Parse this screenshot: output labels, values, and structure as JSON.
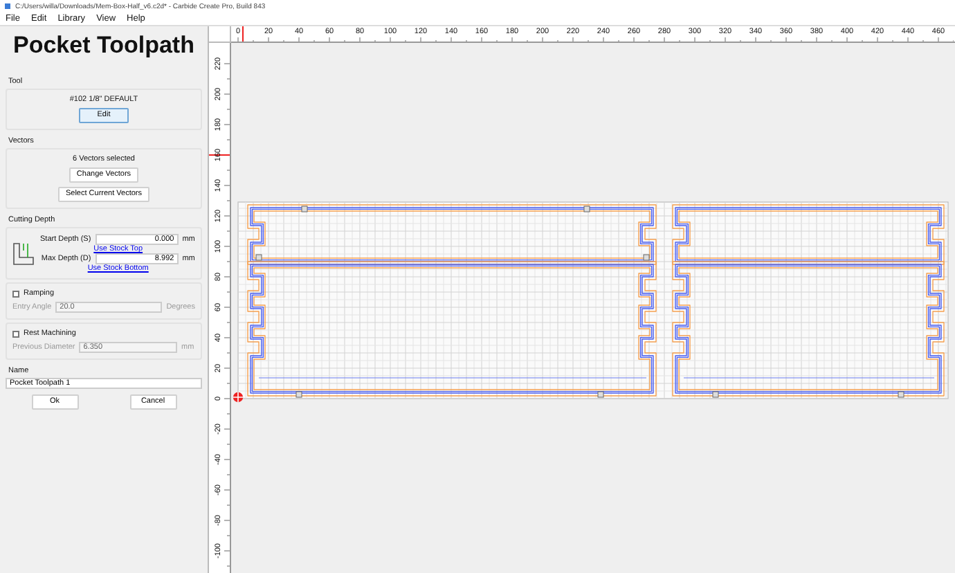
{
  "window": {
    "title": "C:/Users/willa/Downloads/Mem-Box-Half_v6.c2d* - Carbide Create Pro, Build 843"
  },
  "menu": [
    "File",
    "Edit",
    "Library",
    "View",
    "Help"
  ],
  "panel": {
    "title": "Pocket Toolpath",
    "tool": {
      "heading": "Tool",
      "name": "#102 1/8\" DEFAULT",
      "button": "Edit"
    },
    "vectors": {
      "heading": "Vectors",
      "summary": "6 Vectors selected",
      "buttons": [
        "Change Vectors",
        "Select Current Vectors"
      ]
    },
    "cutting_depth": {
      "heading": "Cutting Depth",
      "rows": [
        {
          "label": "Start Depth (S)",
          "value": "0.000",
          "unit": "mm",
          "link": "Use Stock Top"
        },
        {
          "label": "Max Depth (D)",
          "value": "8.992",
          "unit": "mm",
          "link": "Use Stock Bottom"
        }
      ]
    },
    "options": [
      {
        "label": "Ramping",
        "checked": false,
        "field_label": "Entry Angle",
        "value": "20.0",
        "unit": "Degrees",
        "disabled": true
      },
      {
        "label": "Rest Machining",
        "checked": false,
        "field_label": "Previous Diameter",
        "value": "6.350",
        "unit": "mm",
        "disabled": true
      }
    ],
    "name": {
      "heading": "Name",
      "value": "Pocket Toolpath 1"
    },
    "buttons": [
      "Ok",
      "Cancel"
    ]
  },
  "rulers": {
    "x_labels": [
      "0",
      "20",
      "40",
      "60",
      "80",
      "100",
      "120",
      "140",
      "160",
      "180",
      "200",
      "220",
      "240",
      "260",
      "280",
      "300",
      "320",
      "340",
      "360",
      "380",
      "400",
      "420",
      "440",
      "460"
    ],
    "y_labels": [
      "220",
      "200",
      "180",
      "160",
      "140",
      "120",
      "100",
      "80",
      "60",
      "40",
      "20",
      "0",
      "-20",
      "-40",
      "-60",
      "-80",
      "-100"
    ]
  }
}
